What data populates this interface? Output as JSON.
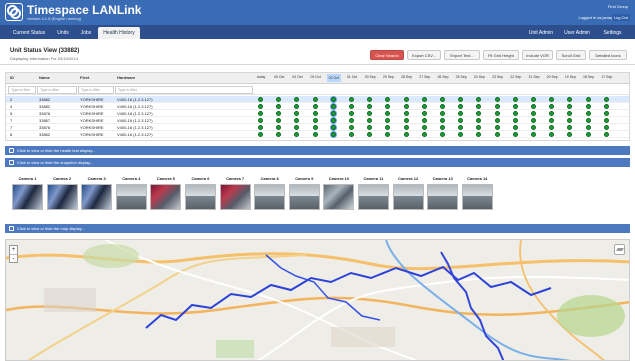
{
  "header": {
    "title": "Timespace LANLink",
    "subtitle": "Version 4.1.5 (Engine running)",
    "group": "First Group",
    "logged_in": "Logged in as jsmay",
    "logout": "Log Out"
  },
  "nav": {
    "left": [
      "Current Status",
      "Units",
      "Jobs",
      "Health History"
    ],
    "right": [
      "Unit Admin",
      "User Admin",
      "Settings"
    ]
  },
  "page": {
    "title": "Unit Status View (33882)",
    "subtitle": "Displaying Information For 03/10/2014"
  },
  "toolbar": [
    "Clear Search",
    "Export CSV...",
    "Export Text...",
    "Fit Grid Height",
    "Include VOR",
    "Scroll Grid",
    "Detailed Icons"
  ],
  "table": {
    "headers": [
      "ID",
      "Name",
      "Fleet",
      "Hardware"
    ],
    "filters": [
      "Type to filter",
      "Type to filter",
      "Type to filter",
      "Type to filter"
    ],
    "dates": [
      "today",
      "05 Oct",
      "04 Oct",
      "03 Oct",
      "02 Oct",
      "01 Oct",
      "30 Sep",
      "29 Sep",
      "28 Sep",
      "27 Sep",
      "26 Sep",
      "25 Sep",
      "24 Sep",
      "23 Sep",
      "22 Sep",
      "21 Sep",
      "20 Sep",
      "19 Sep",
      "18 Sep",
      "17 Sep"
    ],
    "rows": [
      {
        "id": "2",
        "name": "33882",
        "fleet": "YORKSHIRE",
        "hardware": "V400-16 (1.2.3.127)"
      },
      {
        "id": "4",
        "name": "33882",
        "fleet": "YORKSHIRE",
        "hardware": "V400-16 (1.2.3.127)"
      },
      {
        "id": "5",
        "name": "33878",
        "fleet": "YORKSHIRE",
        "hardware": "V400-16 (1.2.3.127)"
      },
      {
        "id": "7",
        "name": "33867",
        "fleet": "YORKSHIRE",
        "hardware": "V400-16 (1.2.3.127)"
      },
      {
        "id": "7",
        "name": "33876",
        "fleet": "YORKSHIRE",
        "hardware": "V400-16 (1.2.3.127)"
      },
      {
        "id": "8",
        "name": "33862",
        "fleet": "YORKSHIRE",
        "hardware": "V400-16 (1.2.3.127)"
      }
    ]
  },
  "sections": {
    "health": "Click to view or hide the health test display...",
    "snapshot": "Click to view or hide the snapshot display...",
    "map": "Click to view or hide the map display..."
  },
  "cameras": [
    "Camera 1",
    "Camera 2",
    "Camera 3",
    "Camera 4",
    "Camera 5",
    "Camera 6",
    "Camera 7",
    "Camera 8",
    "Camera 9",
    "Camera 10",
    "Camera 11",
    "Camera 12",
    "Camera 13",
    "Camera 14"
  ],
  "map_controls": {
    "zoom_in": "+",
    "zoom_out": "-"
  },
  "icons": {
    "logo": "app-logo-icon",
    "section": "panel-icon",
    "layers": "layers-icon"
  },
  "colors": {
    "header": "#3a6bb5",
    "nav": "#2d4f8e",
    "section": "#4d79c1",
    "status_ok": "#1d9d38",
    "clear": "#d9534f"
  }
}
